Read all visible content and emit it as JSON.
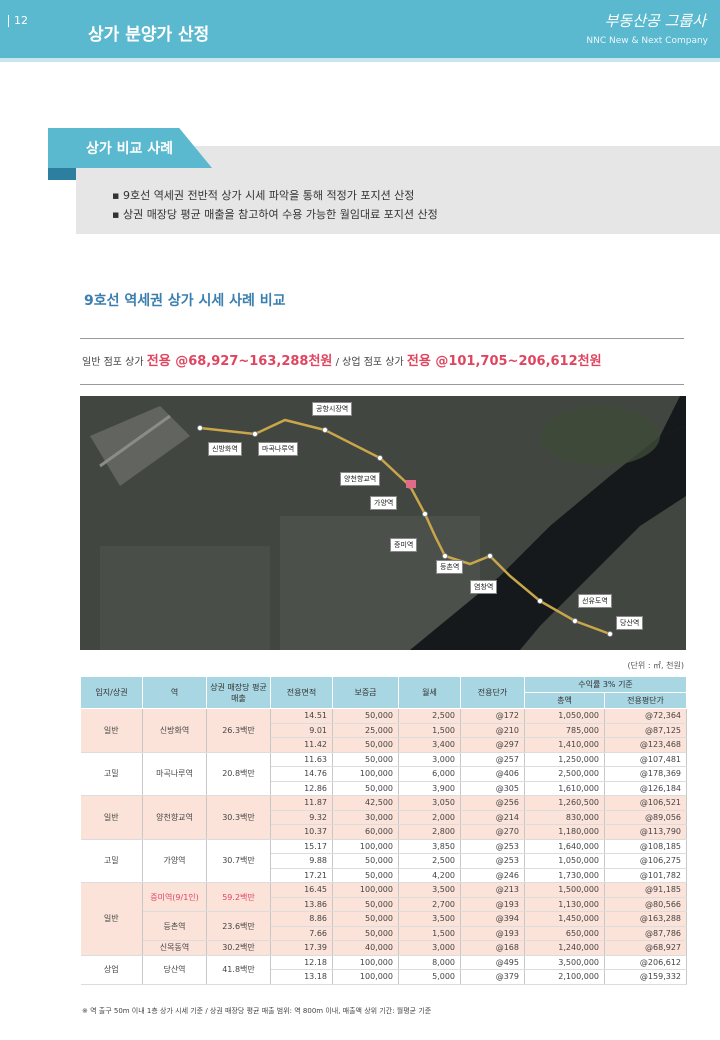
{
  "header": {
    "page_number": "12",
    "section_title": "상가 분양가 산정",
    "logo": "부동산공 그룹사",
    "tagline": "NNC New & Next Company"
  },
  "comparison": {
    "title": "상가 비교 사례",
    "bullets": [
      "9호선 역세권 전반적 상가 시세 파악을 통해 적정가 포지션 산정",
      "상권 매장당 평균 매출을 참고하여 수용 가능한 월임대료 포지션 산정"
    ]
  },
  "subheading": "9호선 역세권 상가 시세 사례 비교",
  "price_summary": {
    "general_label": "일반 점포 상가",
    "general_value": "전용 @68,927~163,288천원",
    "separator": "/",
    "premium_label": "상업 점포 상가",
    "premium_value": "전용 @101,705~206,612천원"
  },
  "map": {
    "stations": [
      "공항시장역",
      "신방화역",
      "마곡나루역",
      "양천향교역",
      "가양역",
      "증미역",
      "등촌역",
      "염창역",
      "신목동역",
      "선유도역",
      "당산역"
    ]
  },
  "unit_note": "(단위 : ㎡, 천원)",
  "table": {
    "headers": {
      "region": "입지/상권",
      "station": "역",
      "avg_sales": "상권 매장당 평균 매출",
      "area": "전용면적",
      "deposit": "보증금",
      "rent": "월세",
      "unit_price": "전용단가",
      "yield_group": "수익률 3% 기준",
      "total": "총액",
      "per_area": "전용평단가"
    },
    "groups": [
      {
        "region": "일반",
        "station": "신방화역",
        "sales": "26.3백만",
        "shade": "pink",
        "rows": [
          [
            "14.51",
            "50,000",
            "2,500",
            "@172",
            "1,050,000",
            "@72,364"
          ],
          [
            "9.01",
            "25,000",
            "1,500",
            "@210",
            "785,000",
            "@87,125"
          ],
          [
            "11.42",
            "50,000",
            "3,400",
            "@297",
            "1,410,000",
            "@123,468"
          ]
        ]
      },
      {
        "region": "고밀",
        "station": "마곡나루역",
        "sales": "20.8백만",
        "shade": "white",
        "rows": [
          [
            "11.63",
            "50,000",
            "3,000",
            "@257",
            "1,250,000",
            "@107,481"
          ],
          [
            "14.76",
            "100,000",
            "6,000",
            "@406",
            "2,500,000",
            "@178,369"
          ],
          [
            "12.86",
            "50,000",
            "3,900",
            "@305",
            "1,610,000",
            "@126,184"
          ]
        ]
      },
      {
        "region": "일반",
        "station": "양천향교역",
        "sales": "30.3백만",
        "shade": "pink",
        "rows": [
          [
            "11.87",
            "42,500",
            "3,050",
            "@256",
            "1,260,500",
            "@106,521"
          ],
          [
            "9.32",
            "30,000",
            "2,000",
            "@214",
            "830,000",
            "@89,056"
          ],
          [
            "10.37",
            "60,000",
            "2,800",
            "@270",
            "1,180,000",
            "@113,790"
          ]
        ]
      },
      {
        "region": "고밀",
        "station": "가양역",
        "sales": "30.7백만",
        "shade": "white",
        "rows": [
          [
            "15.17",
            "100,000",
            "3,850",
            "@253",
            "1,640,000",
            "@108,185"
          ],
          [
            "9.88",
            "50,000",
            "2,500",
            "@253",
            "1,050,000",
            "@106,275"
          ],
          [
            "17.21",
            "50,000",
            "4,200",
            "@246",
            "1,730,000",
            "@101,782"
          ]
        ]
      },
      {
        "region": "일반",
        "shade": "pink",
        "subgroups": [
          {
            "station": "증미역(9/1인)",
            "sales": "59.2백만",
            "highlight": true,
            "rows": [
              [
                "16.45",
                "100,000",
                "3,500",
                "@213",
                "1,500,000",
                "@91,185"
              ],
              [
                "13.86",
                "50,000",
                "2,700",
                "@193",
                "1,130,000",
                "@80,566"
              ]
            ]
          },
          {
            "station": "등촌역",
            "sales": "23.6백만",
            "highlight": false,
            "rows": [
              [
                "8.86",
                "50,000",
                "3,500",
                "@394",
                "1,450,000",
                "@163,288"
              ],
              [
                "7.66",
                "50,000",
                "1,500",
                "@193",
                "650,000",
                "@87,786"
              ]
            ]
          },
          {
            "station": "신목동역",
            "sales": "30.2백만",
            "highlight": false,
            "rows": [
              [
                "17.39",
                "40,000",
                "3,000",
                "@168",
                "1,240,000",
                "@68,927"
              ]
            ]
          }
        ]
      },
      {
        "region": "상업",
        "station": "당산역",
        "sales": "41.8백만",
        "shade": "white",
        "rows": [
          [
            "12.18",
            "100,000",
            "8,000",
            "@495",
            "3,500,000",
            "@206,612"
          ],
          [
            "13.18",
            "100,000",
            "5,000",
            "@379",
            "2,100,000",
            "@159,332"
          ]
        ]
      }
    ]
  },
  "footnote": "※ 역 출구 50m 이내 1층 상가 시세 기준 / 상권 매장당 평균 매출 범위: 역 800m 이내, 매출액 상위 기간: 월평균 기준"
}
